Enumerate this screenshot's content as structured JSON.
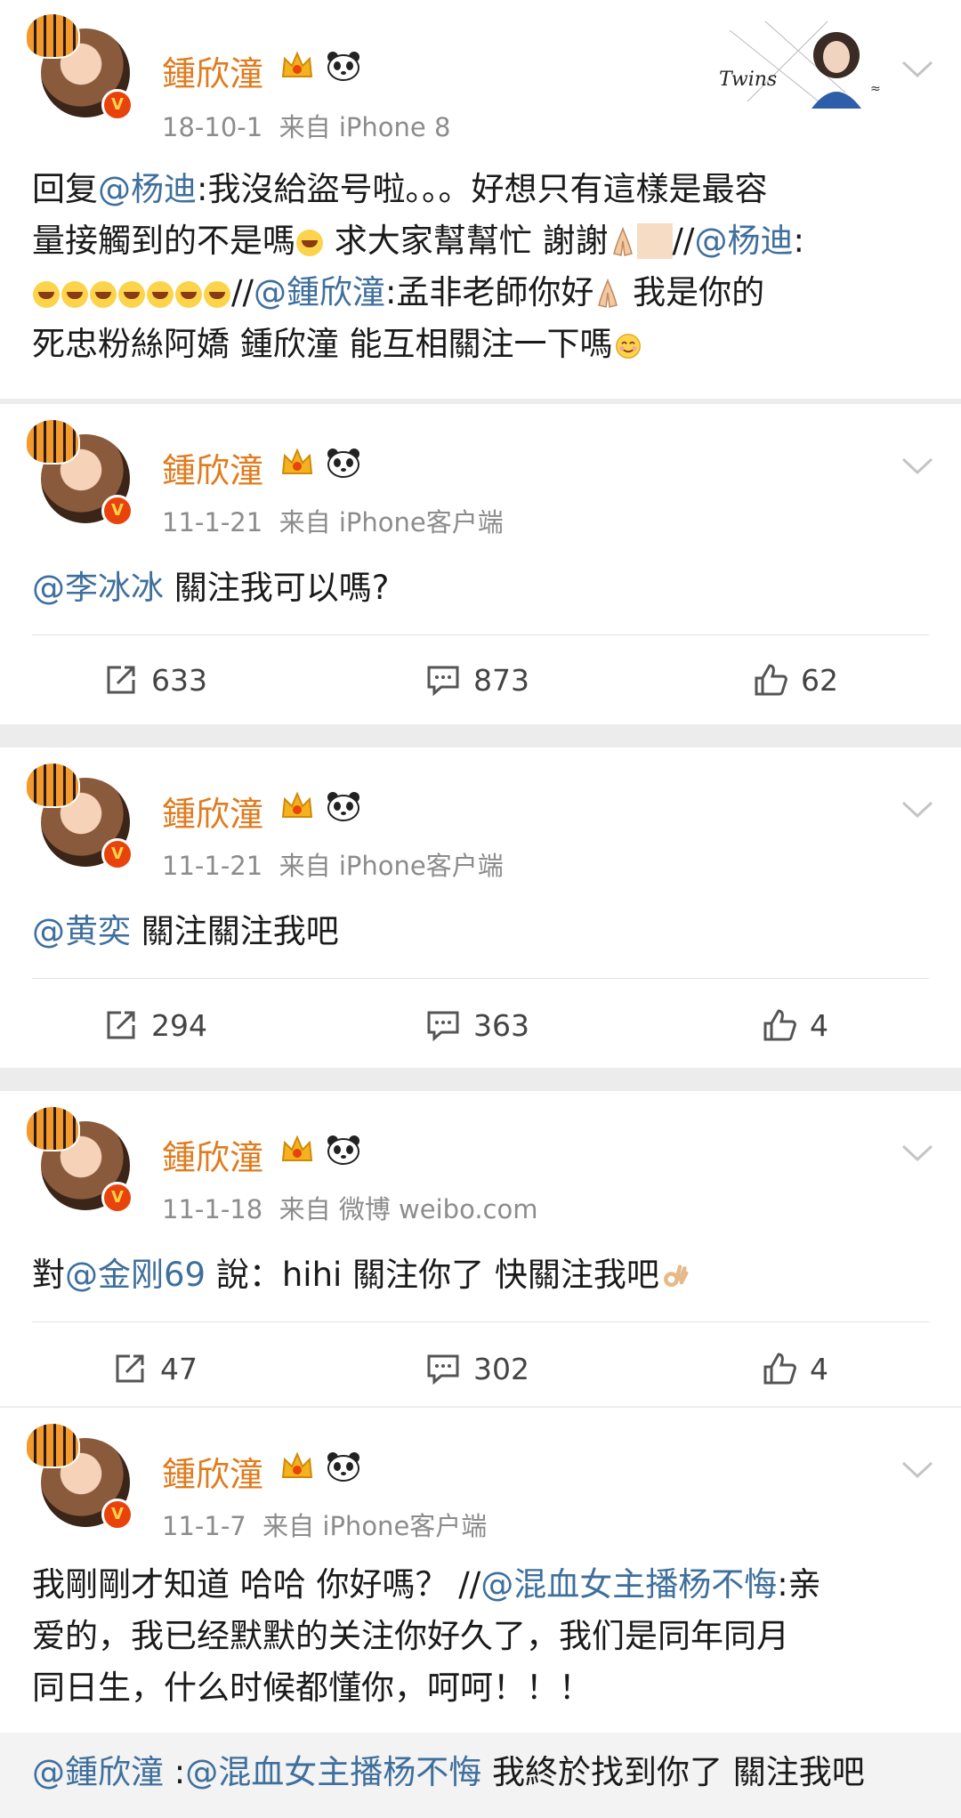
{
  "brand": {
    "name_color": "#e07b1e",
    "link_color": "#3f6f9c"
  },
  "posts": [
    {
      "name": "鍾欣潼",
      "date": "18-10-1",
      "source": "来自 iPhone 8",
      "signature_image": "Twins",
      "text_lines": [
        {
          "a": "回复",
          "m1": "@杨迪",
          "b": ":我沒給盜号啦。。。好想只有這樣是最容"
        },
        {
          "a": "量接觸到的不是嗎",
          "b": " 求大家幫幫忙 謝謝",
          "c": "//",
          "m1": "@杨迪",
          "d": ":"
        },
        {
          "a": "//",
          "m1": "@鍾欣潼",
          "b": ":孟非老師你好",
          "c": " 我是你的"
        },
        {
          "a": "死忠粉絲阿嬌 鍾欣潼 能互相關注一下嗎"
        }
      ]
    },
    {
      "name": "鍾欣潼",
      "date": "11-1-21",
      "source": "来自 iPhone客户端",
      "mention": "@李冰冰",
      "text": " 關注我可以嗎?",
      "repost": "633",
      "comment": "873",
      "like": "62"
    },
    {
      "name": "鍾欣潼",
      "date": "11-1-21",
      "source": "来自 iPhone客户端",
      "mention": "@黄奕",
      "text": " 關注關注我吧",
      "repost": "294",
      "comment": "363",
      "like": "4"
    },
    {
      "name": "鍾欣潼",
      "date": "11-1-18",
      "source": "来自 微博 weibo.com",
      "prefix": "對",
      "mention": "@金刚69",
      "text": " 說：hihi 關注你了 快關注我吧",
      "repost": "47",
      "comment": "302",
      "like": "4"
    },
    {
      "name": "鍾欣潼",
      "date": "11-1-7",
      "source": "来自 iPhone客户端",
      "line1_a": "我剛剛才知道 哈哈 你好嗎？ //",
      "line1_m": "@混血女主播杨不悔",
      "line1_b": ":亲",
      "line2": "爱的，我已经默默的关注你好久了，我们是同年同月",
      "line3": "同日生，什么时候都懂你，呵呵！！！",
      "quote_mention1": "@鍾欣潼",
      "quote_sep": " :",
      "quote_mention2": "@混血女主播杨不悔",
      "quote_text": " 我終於找到你了 關注我吧"
    }
  ]
}
